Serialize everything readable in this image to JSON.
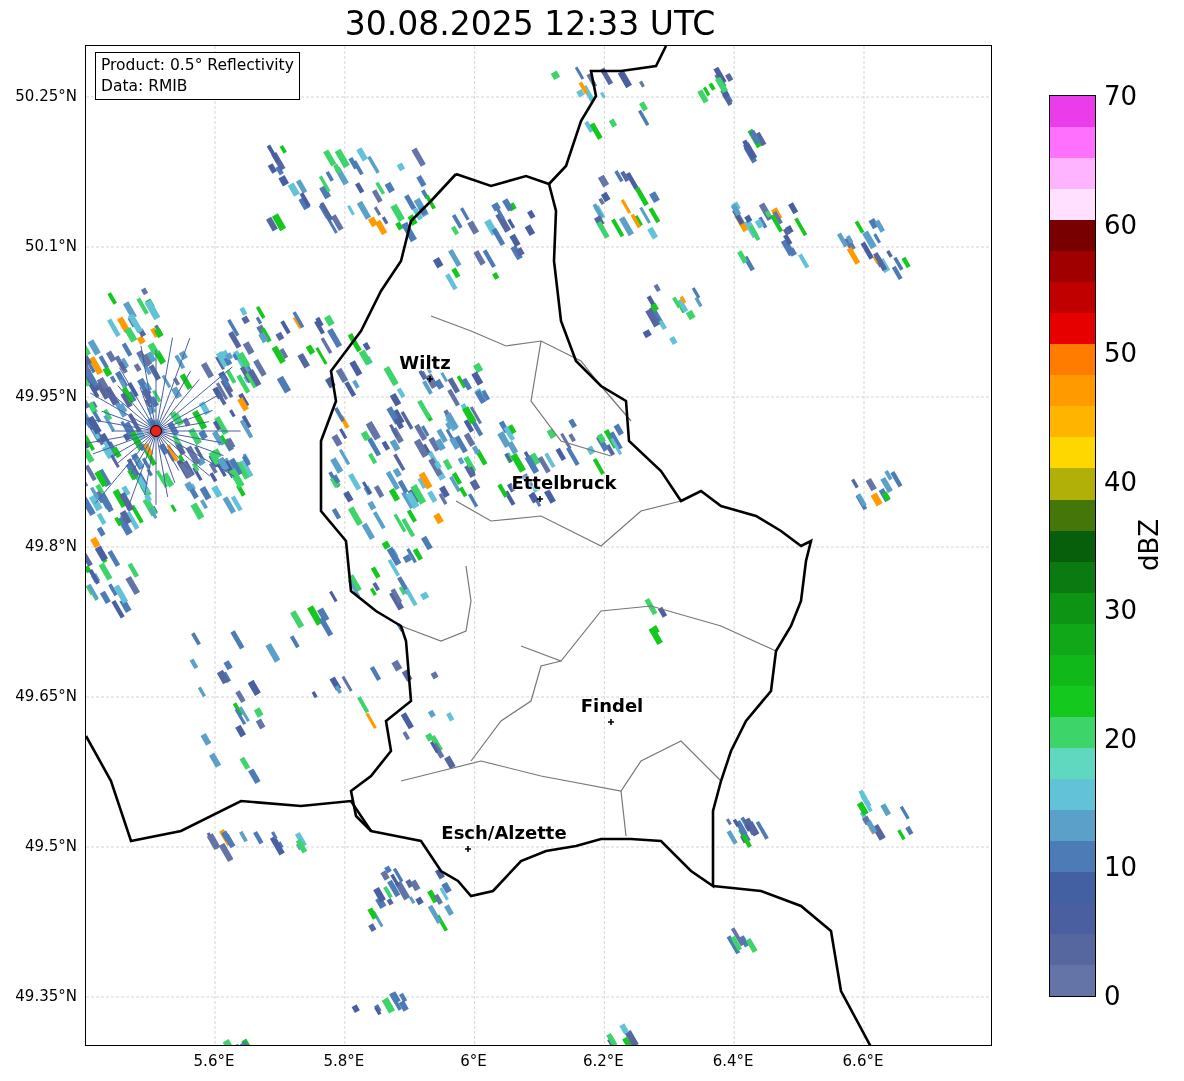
{
  "title": "30.08.2025 12:33 UTC",
  "info_box": {
    "lines": [
      "Product: 0.5° Reflectivity",
      "Data: RMIB"
    ]
  },
  "x_ticks": [
    "5.6°E",
    "5.8°E",
    "6°E",
    "6.2°E",
    "6.4°E",
    "6.6°E"
  ],
  "y_ticks": [
    "50.25°N",
    "50.1°N",
    "49.95°N",
    "49.8°N",
    "49.65°N",
    "49.5°N",
    "49.35°N"
  ],
  "cities": [
    {
      "name": "Wiltz"
    },
    {
      "name": "Ettelbruck"
    },
    {
      "name": "Findel"
    },
    {
      "name": "Esch/Alzette"
    }
  ],
  "colorbar": {
    "label": "dBZ",
    "ticks": [
      "70",
      "60",
      "50",
      "40",
      "30",
      "20",
      "10",
      "0"
    ],
    "bins": [
      {
        "color": "#6474a6"
      },
      {
        "color": "#55679e"
      },
      {
        "color": "#4a5fa0"
      },
      {
        "color": "#4360a2"
      },
      {
        "color": "#4c7bb5"
      },
      {
        "color": "#5ba0c8"
      },
      {
        "color": "#62c2d8"
      },
      {
        "color": "#60d8c0"
      },
      {
        "color": "#3dd46a"
      },
      {
        "color": "#14c81e"
      },
      {
        "color": "#10b81a"
      },
      {
        "color": "#10a818"
      },
      {
        "color": "#0e9414"
      },
      {
        "color": "#0b7a10"
      },
      {
        "color": "#075f0c"
      },
      {
        "color": "#44760a"
      },
      {
        "color": "#b0b008"
      },
      {
        "color": "#ffd700"
      },
      {
        "color": "#ffb400"
      },
      {
        "color": "#ff9a00"
      },
      {
        "color": "#ff7c00"
      },
      {
        "color": "#e60000"
      },
      {
        "color": "#c00000"
      },
      {
        "color": "#a00000"
      },
      {
        "color": "#780000"
      },
      {
        "color": "#ffe0ff"
      },
      {
        "color": "#ffb4ff"
      },
      {
        "color": "#ff70ff"
      },
      {
        "color": "#ea3cea"
      }
    ]
  }
}
